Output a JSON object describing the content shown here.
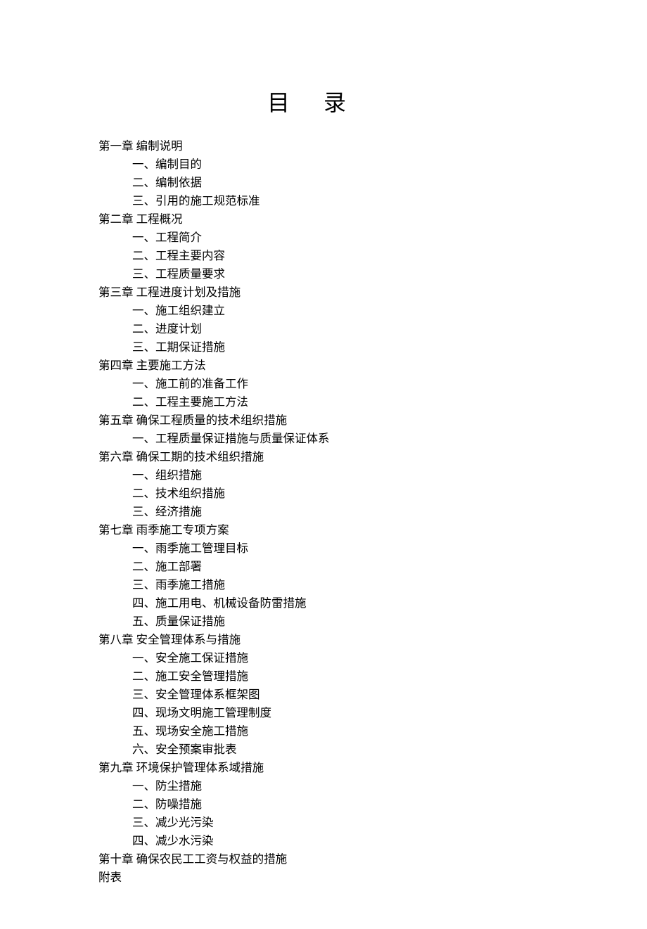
{
  "title": "目录",
  "toc": [
    {
      "type": "chapter",
      "label": "第一章 编制说明"
    },
    {
      "type": "section",
      "label": "一、编制目的"
    },
    {
      "type": "section",
      "label": "二、编制依据"
    },
    {
      "type": "section",
      "label": "三、引用的施工规范标准"
    },
    {
      "type": "chapter",
      "label": "第二章 工程概况"
    },
    {
      "type": "section",
      "label": "一、工程简介"
    },
    {
      "type": "section",
      "label": "二、工程主要内容"
    },
    {
      "type": "section",
      "label": "三、工程质量要求"
    },
    {
      "type": "chapter",
      "label": "第三章 工程进度计划及措施"
    },
    {
      "type": "section",
      "label": "一、施工组织建立"
    },
    {
      "type": "section",
      "label": "二、进度计划"
    },
    {
      "type": "section",
      "label": "三、工期保证措施"
    },
    {
      "type": "chapter",
      "label": "第四章 主要施工方法"
    },
    {
      "type": "section",
      "label": "一、施工前的准备工作"
    },
    {
      "type": "section",
      "label": "二、工程主要施工方法"
    },
    {
      "type": "chapter",
      "label": "第五章 确保工程质量的技术组织措施"
    },
    {
      "type": "section",
      "label": "一、工程质量保证措施与质量保证体系"
    },
    {
      "type": "chapter",
      "label": "第六章 确保工期的技术组织措施"
    },
    {
      "type": "section",
      "label": "一、组织措施"
    },
    {
      "type": "section",
      "label": "二、技术组织措施"
    },
    {
      "type": "section",
      "label": "三、经济措施"
    },
    {
      "type": "chapter",
      "label": "第七章 雨季施工专项方案"
    },
    {
      "type": "section",
      "label": "一、雨季施工管理目标"
    },
    {
      "type": "section",
      "label": "二、施工部署"
    },
    {
      "type": "section",
      "label": "三、雨季施工措施"
    },
    {
      "type": "section",
      "label": "四、施工用电、机械设备防雷措施"
    },
    {
      "type": "section",
      "label": "五、质量保证措施"
    },
    {
      "type": "chapter",
      "label": "第八章 安全管理体系与措施"
    },
    {
      "type": "section",
      "label": "一、安全施工保证措施"
    },
    {
      "type": "section",
      "label": "二、施工安全管理措施"
    },
    {
      "type": "section",
      "label": "三、安全管理体系框架图"
    },
    {
      "type": "section",
      "label": "四、现场文明施工管理制度"
    },
    {
      "type": "section",
      "label": "五、现场安全施工措施"
    },
    {
      "type": "section",
      "label": "六、安全预案审批表"
    },
    {
      "type": "chapter",
      "label": "第九章 环境保护管理体系域措施"
    },
    {
      "type": "section",
      "label": "一、防尘措施"
    },
    {
      "type": "section",
      "label": "二、防噪措施"
    },
    {
      "type": "section",
      "label": "三、减少光污染"
    },
    {
      "type": "section",
      "label": "四、减少水污染"
    },
    {
      "type": "chapter",
      "label": "第十章 确保农民工工资与权益的措施"
    },
    {
      "type": "chapter",
      "label": "附表"
    }
  ]
}
